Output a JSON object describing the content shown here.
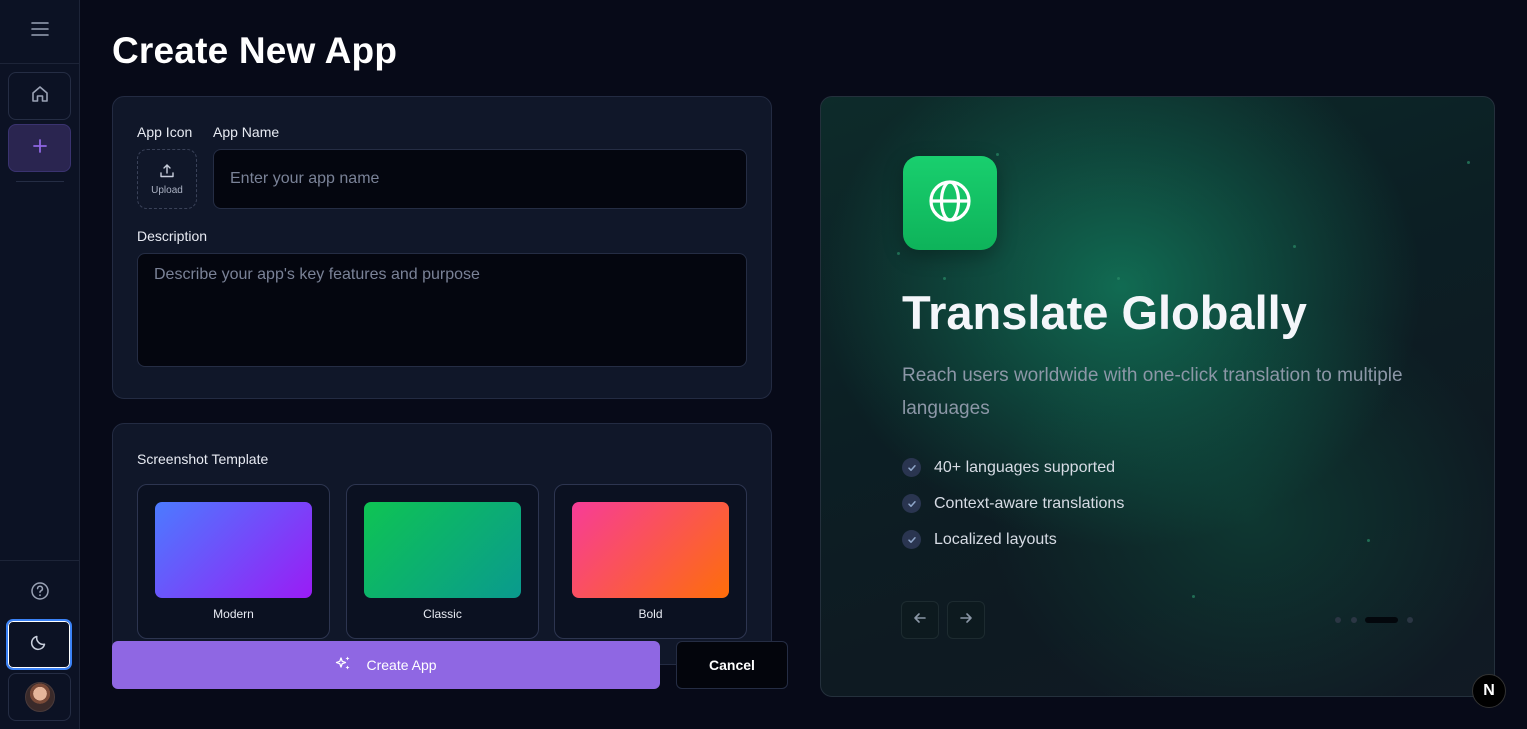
{
  "page": {
    "title": "Create New App"
  },
  "form": {
    "app_icon_label": "App Icon",
    "upload_label": "Upload",
    "app_name_label": "App Name",
    "app_name_placeholder": "Enter your app name",
    "description_label": "Description",
    "description_placeholder": "Describe your app's key features and purpose",
    "template_label": "Screenshot Template",
    "templates": [
      {
        "name": "Modern",
        "gradient": [
          "#4b7bff",
          "#9a1cf5"
        ]
      },
      {
        "name": "Classic",
        "gradient": [
          "#0ec453",
          "#0a9a8e"
        ]
      },
      {
        "name": "Bold",
        "gradient": [
          "#f73c98",
          "#fe6e09"
        ]
      }
    ]
  },
  "actions": {
    "create_label": "Create App",
    "cancel_label": "Cancel"
  },
  "showcase": {
    "title": "Translate Globally",
    "description": "Reach users worldwide with one-click translation to multiple languages",
    "features": [
      "40+ languages supported",
      "Context-aware translations",
      "Localized layouts"
    ],
    "icon": "globe-icon",
    "pagination": {
      "total": 4,
      "active": 3
    }
  },
  "colors": {
    "accent": "#8f67e3",
    "app_tile": "#12c764",
    "focus_ring": "#3b82f6"
  },
  "badge": {
    "label": "N"
  }
}
